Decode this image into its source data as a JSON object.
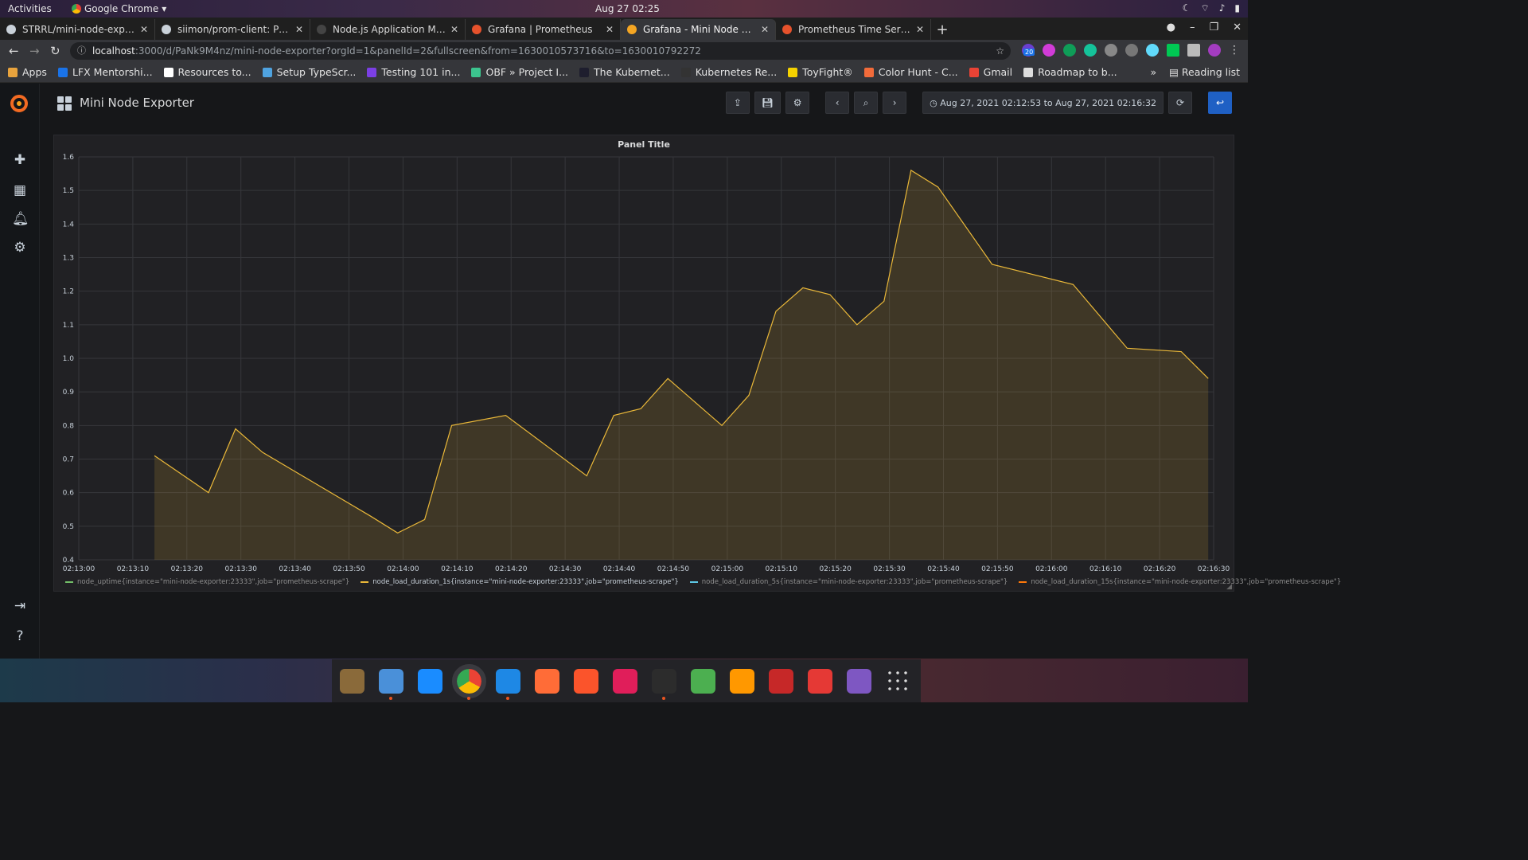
{
  "system": {
    "activities": "Activities",
    "app_name": "Google Chrome",
    "clock": "Aug 27  02:25"
  },
  "browser": {
    "tabs": [
      {
        "title": "STRRL/mini-node-exporte",
        "color": "#c9d1d9",
        "active": false
      },
      {
        "title": "siimon/prom-client: Prom",
        "color": "#c9d1d9",
        "active": false
      },
      {
        "title": "Node.js Application Moni",
        "color": "#444444",
        "active": false
      },
      {
        "title": "Grafana | Prometheus",
        "color": "#e6522c",
        "active": false
      },
      {
        "title": "Grafana - Mini Node Expo",
        "color": "#f5a623",
        "active": true
      },
      {
        "title": "Prometheus Time Series C",
        "color": "#e6522c",
        "active": false
      }
    ],
    "url_host": "localhost",
    "url_rest": ":3000/d/PaNk9M4nz/mini-node-exporter?orgId=1&panelId=2&fullscreen&from=1630010573716&to=1630010792272",
    "ext_badge": "20",
    "bookmarks": [
      {
        "label": "Apps",
        "color": "#e8a33d"
      },
      {
        "label": "LFX Mentorshi...",
        "color": "#1a73e8"
      },
      {
        "label": "Resources to...",
        "color": "#ffffff"
      },
      {
        "label": "Setup TypeScr...",
        "color": "#4fa3e0"
      },
      {
        "label": "Testing 101 in...",
        "color": "#7b3fe4"
      },
      {
        "label": "OBF » Project I...",
        "color": "#3cc48e"
      },
      {
        "label": "The Kubernet...",
        "color": "#1e1e2e"
      },
      {
        "label": "Kubernetes Re...",
        "color": "#333333"
      },
      {
        "label": "ToyFight®",
        "color": "#f5d200"
      },
      {
        "label": "Color Hunt - C...",
        "color": "#f26b3a"
      },
      {
        "label": "Gmail",
        "color": "#ea4335"
      },
      {
        "label": "Roadmap to b...",
        "color": "#dddddd"
      }
    ],
    "more": "»",
    "reading_list": "Reading list"
  },
  "grafana": {
    "dashboard_title": "Mini Node Exporter",
    "time_range": "Aug 27, 2021 02:12:53 to Aug 27, 2021 02:16:32",
    "panel_title": "Panel Title"
  },
  "chart_data": {
    "type": "area",
    "title": "Panel Title",
    "ylim": [
      0.4,
      1.6
    ],
    "yticks": [
      "1.6",
      "1.5",
      "1.4",
      "1.3",
      "1.2",
      "1.1",
      "1.0",
      "0.9",
      "0.8",
      "0.7",
      "0.6",
      "0.5",
      "0.4"
    ],
    "xticks": [
      "02:13:00",
      "02:13:10",
      "02:13:20",
      "02:13:30",
      "02:13:40",
      "02:13:50",
      "02:14:00",
      "02:14:10",
      "02:14:20",
      "02:14:30",
      "02:14:40",
      "02:14:50",
      "02:15:00",
      "02:15:10",
      "02:15:20",
      "02:15:30",
      "02:15:40",
      "02:15:50",
      "02:16:00",
      "02:16:10",
      "02:16:20",
      "02:16:30"
    ],
    "grid": true,
    "legend_position": "bottom",
    "series": [
      {
        "name": "node_uptime{instance=\"mini-node-exporter:23333\",job=\"prometheus-scrape\"}",
        "color": "#73bf69",
        "visible": false,
        "values": []
      },
      {
        "name": "node_load_duration_1s{instance=\"mini-node-exporter:23333\",job=\"prometheus-scrape\"}",
        "color": "#eab839",
        "visible": true,
        "values": [
          [
            "02:13:14",
            0.71
          ],
          [
            "02:13:24",
            0.6
          ],
          [
            "02:13:29",
            0.79
          ],
          [
            "02:13:34",
            0.72
          ],
          [
            "02:13:54",
            0.53
          ],
          [
            "02:13:59",
            0.48
          ],
          [
            "02:14:04",
            0.52
          ],
          [
            "02:14:09",
            0.8
          ],
          [
            "02:14:19",
            0.83
          ],
          [
            "02:14:34",
            0.65
          ],
          [
            "02:14:39",
            0.83
          ],
          [
            "02:14:44",
            0.85
          ],
          [
            "02:14:49",
            0.94
          ],
          [
            "02:14:59",
            0.8
          ],
          [
            "02:15:04",
            0.89
          ],
          [
            "02:15:09",
            1.14
          ],
          [
            "02:15:14",
            1.21
          ],
          [
            "02:15:19",
            1.19
          ],
          [
            "02:15:24",
            1.1
          ],
          [
            "02:15:29",
            1.17
          ],
          [
            "02:15:34",
            1.56
          ],
          [
            "02:15:39",
            1.51
          ],
          [
            "02:15:49",
            1.28
          ],
          [
            "02:16:04",
            1.22
          ],
          [
            "02:16:14",
            1.03
          ],
          [
            "02:16:24",
            1.02
          ],
          [
            "02:16:29",
            0.94
          ]
        ]
      },
      {
        "name": "node_load_duration_5s{instance=\"mini-node-exporter:23333\",job=\"prometheus-scrape\"}",
        "color": "#5ec8e5",
        "visible": false,
        "values": []
      },
      {
        "name": "node_load_duration_15s{instance=\"mini-node-exporter:23333\",job=\"prometheus-scrape\"}",
        "color": "#ff780a",
        "visible": false,
        "values": []
      }
    ]
  },
  "dock": {
    "apps": [
      {
        "name": "gimp",
        "color": "#8a6a3a"
      },
      {
        "name": "files",
        "color": "#4a90d9"
      },
      {
        "name": "app-store",
        "color": "#1a8cff"
      },
      {
        "name": "chrome",
        "color": "#ea4335"
      },
      {
        "name": "vscode",
        "color": "#1e88e5"
      },
      {
        "name": "postman",
        "color": "#ff6c37"
      },
      {
        "name": "brave",
        "color": "#fb542b"
      },
      {
        "name": "slack",
        "color": "#e01e5a"
      },
      {
        "name": "terminal",
        "color": "#2c2c2c"
      },
      {
        "name": "git-client",
        "color": "#4caf50"
      },
      {
        "name": "media-player",
        "color": "#ff9800"
      },
      {
        "name": "video-editor",
        "color": "#c62828"
      },
      {
        "name": "downloader",
        "color": "#e53935"
      },
      {
        "name": "screenshot",
        "color": "#7e57c2"
      },
      {
        "name": "app-grid",
        "color": "#232327"
      }
    ]
  }
}
